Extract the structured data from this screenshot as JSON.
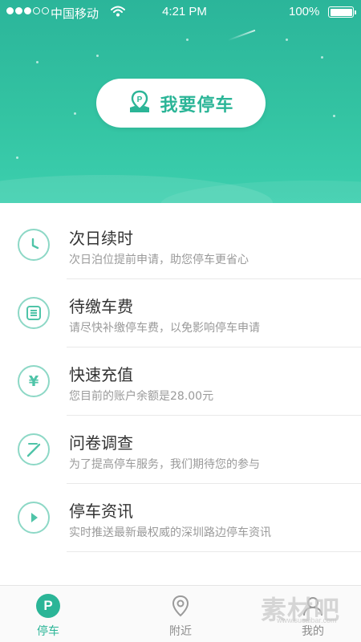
{
  "status_bar": {
    "carrier": "中国移动",
    "time": "4:21 PM",
    "battery": "100%",
    "signal_strength": "3 of 5"
  },
  "hero": {
    "park_button_label": "我要停车",
    "accent_color": "#2bb597"
  },
  "services": [
    {
      "title": "次日续时",
      "description": "次日泊位提前申请，助您停车更省心",
      "icon": "clock-icon"
    },
    {
      "title": "待缴车费",
      "description": "请尽快补缴停车费，以免影响停车申请",
      "icon": "list-icon"
    },
    {
      "title": "快速充值",
      "description": "您目前的账户余额是28.00元",
      "icon": "yen-icon"
    },
    {
      "title": "问卷调查",
      "description": "为了提高停车服务，我们期待您的参与",
      "icon": "pencil-icon"
    },
    {
      "title": "停车资讯",
      "description": "实时推送最新最权威的深圳路边停车资讯",
      "icon": "play-icon"
    }
  ],
  "tabs": [
    {
      "label": "停车",
      "icon": "parking-icon",
      "active": true
    },
    {
      "label": "附近",
      "icon": "location-pin-icon",
      "active": false
    },
    {
      "label": "我的",
      "icon": "user-icon",
      "active": false
    }
  ],
  "watermark": {
    "text": "素材吧",
    "url": "www.sucaibar.com"
  }
}
